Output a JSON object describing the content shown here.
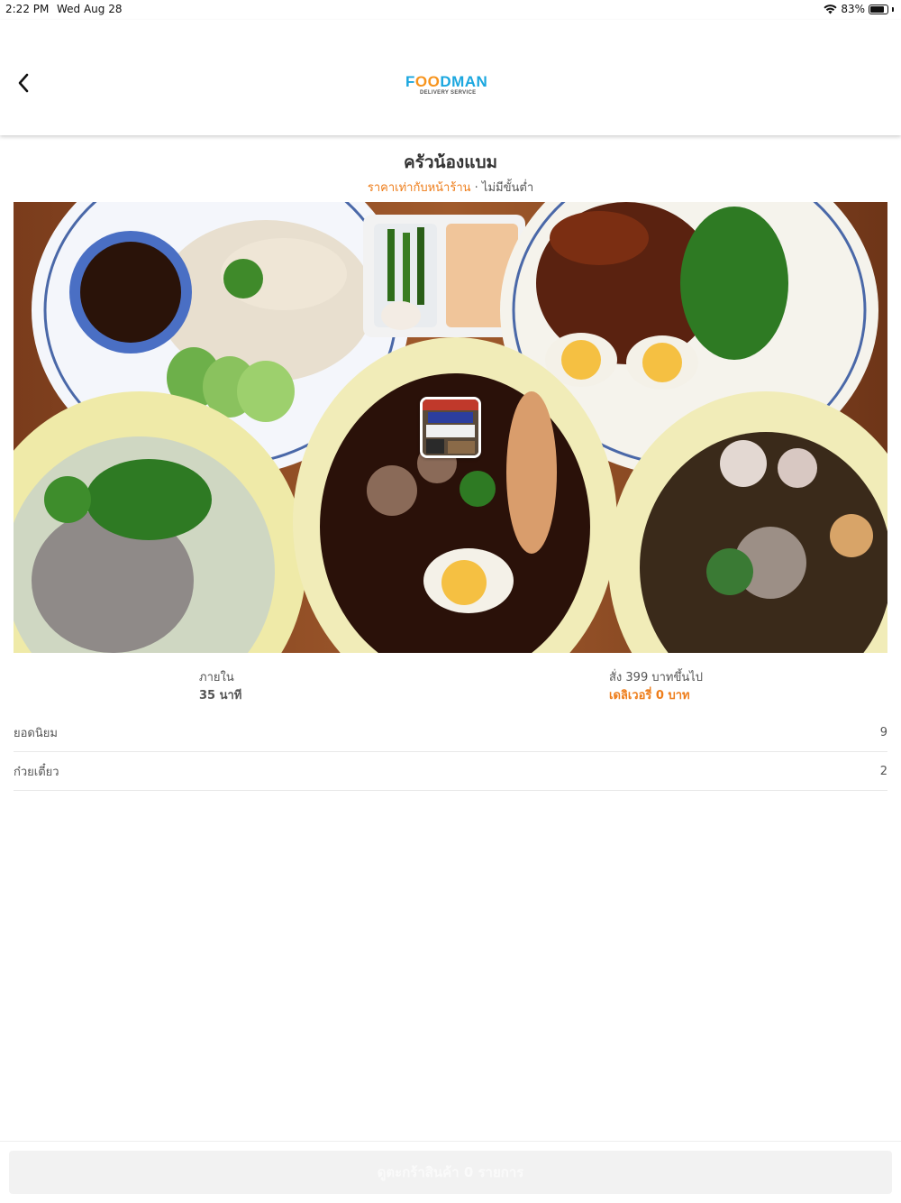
{
  "status_bar": {
    "time": "2:22 PM",
    "date": "Wed Aug 28",
    "battery": "83%",
    "battery_level": 0.83
  },
  "nav": {
    "back_icon": "chevron-left-icon",
    "logo_word_1": "F",
    "logo_word_o": "OO",
    "logo_word_2": "DMAN",
    "logo_sub": "DELIVERY SERVICE"
  },
  "store": {
    "name": "ครัวน้องแบม",
    "price_note": "ราคาเท่ากับหน้าร้าน",
    "separator": " · ",
    "minimum_note": "ไม่มีขั้นต่ำ"
  },
  "info": {
    "time_label": "ภายใน",
    "time_value": "35 นาที",
    "delivery_label": "สั่ง 399 บาทขึ้นไป",
    "delivery_value": "เดลิเวอรี่ 0 บาท"
  },
  "categories": [
    {
      "label": "ยอดนิยม",
      "count": "9"
    },
    {
      "label": "ก๋วยเตี๋ยว",
      "count": "2"
    }
  ],
  "cart": {
    "label": "ดูตะกร้าสินค้า 0 รายการ"
  },
  "colors": {
    "accent": "#ee7d1a",
    "logo_blue": "#1ba7df"
  }
}
